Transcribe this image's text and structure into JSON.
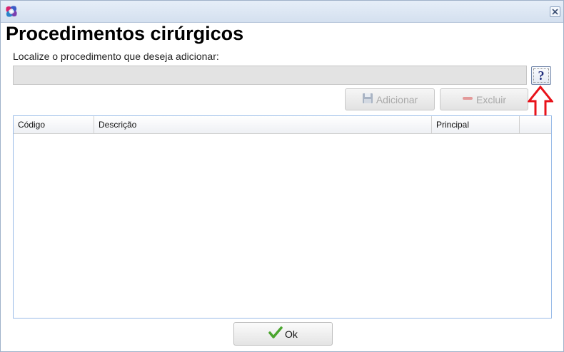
{
  "window": {
    "title": "Procedimentos cirúrgicos",
    "app_icon": "app-logo-icon",
    "close_icon": "close-icon"
  },
  "search": {
    "label": "Localize o procedimento que deseja adicionar:",
    "value": "",
    "placeholder": "",
    "help_label": "?"
  },
  "toolbar": {
    "add_label": "Adicionar",
    "add_icon": "save-disk-icon",
    "delete_label": "Excluir",
    "delete_icon": "minus-icon"
  },
  "grid": {
    "columns": [
      "Código",
      "Descrição",
      "Principal",
      ""
    ],
    "rows": []
  },
  "footer": {
    "ok_label": "Ok",
    "ok_icon": "checkmark-icon"
  },
  "colors": {
    "annotation_arrow": "#e8121a",
    "grid_border": "#99bbe8"
  }
}
